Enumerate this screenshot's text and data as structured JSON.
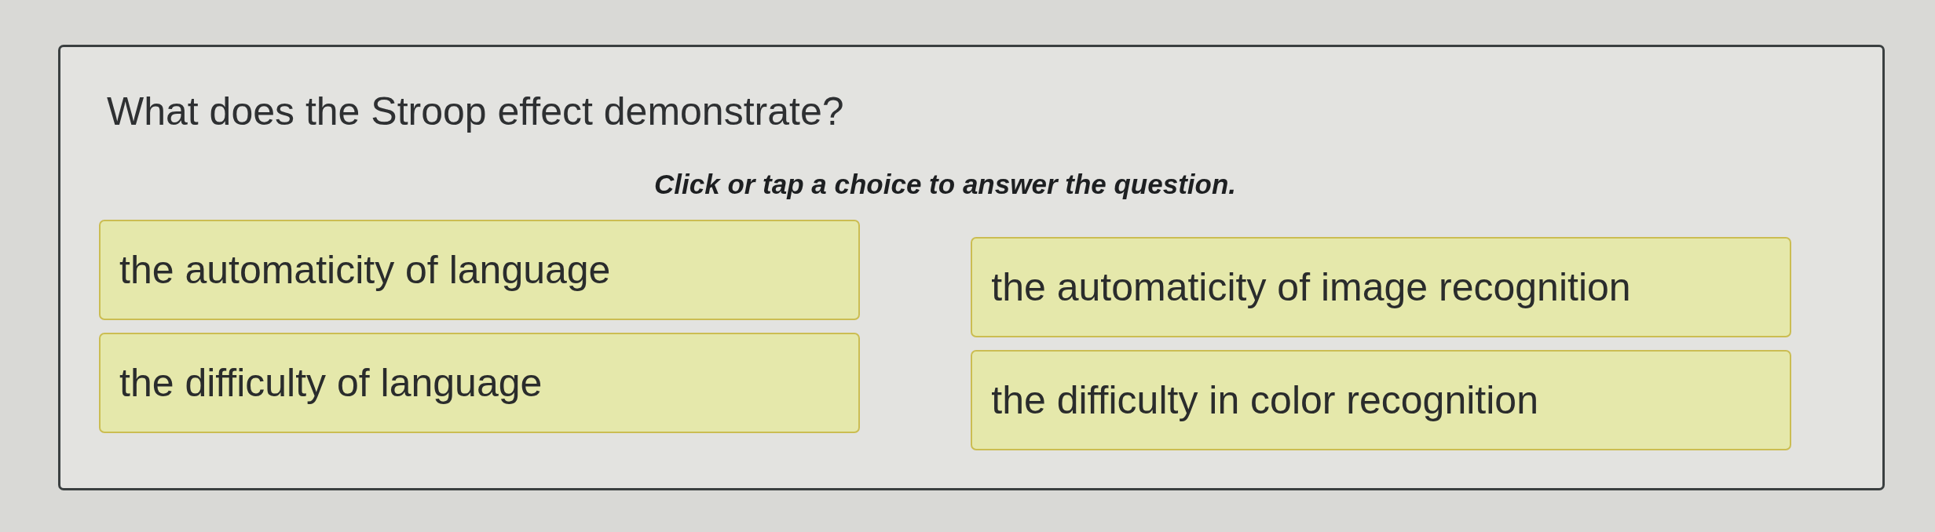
{
  "question": {
    "text": "What does the Stroop effect demonstrate?",
    "instruction": "Click or tap a choice to answer the question."
  },
  "choices": [
    {
      "label": "the automaticity of language",
      "selected": false
    },
    {
      "label": "the difficulty of language",
      "selected": false
    },
    {
      "label": "the automaticity of image recognition",
      "selected": false
    },
    {
      "label": "the difficulty in color recognition",
      "selected": false
    }
  ]
}
